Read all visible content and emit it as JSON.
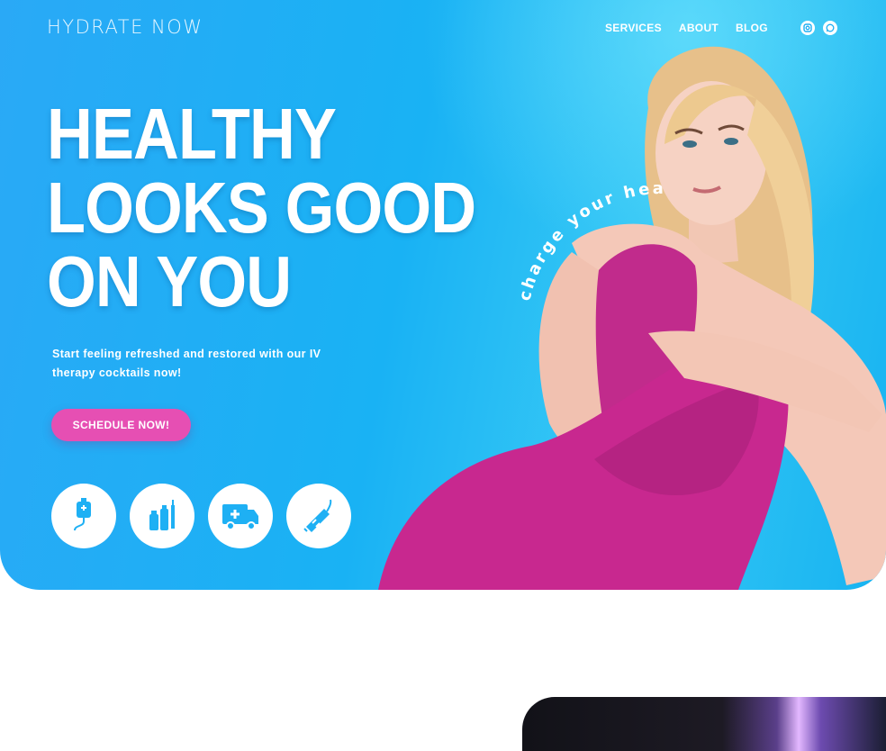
{
  "brand": {
    "logo": "HYDRATE NOW"
  },
  "nav": {
    "items": [
      "SERVICES",
      "ABOUT",
      "BLOG"
    ]
  },
  "social": {
    "icons": [
      "instagram-icon",
      "whatsapp-icon"
    ]
  },
  "hero": {
    "headline_lines": [
      "HEALTHY",
      "LOOKS GOOD",
      "ON YOU"
    ],
    "subtext": "Start feeling refreshed and restored with our IV therapy cocktails now!",
    "cta_label": "SCHEDULE NOW!",
    "arc_text": "charge your health",
    "features": [
      "iv-bag-icon",
      "vials-syringe-icon",
      "mobile-van-icon",
      "injection-pen-icon"
    ]
  },
  "colors": {
    "hero_blue": "#1eb0f4",
    "accent_pink": "#e64fb3",
    "outfit_magenta": "#c42a8e"
  }
}
